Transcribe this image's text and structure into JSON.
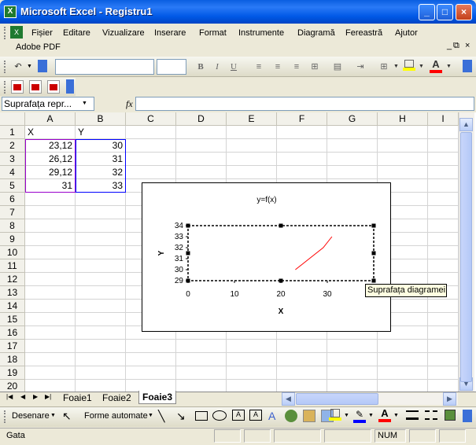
{
  "window": {
    "title": "Microsoft Excel - Registru1",
    "controls": [
      "_",
      "□",
      "×"
    ]
  },
  "menu": {
    "items": [
      "Fișier",
      "Editare",
      "Vizualizare",
      "Inserare",
      "Format",
      "Instrumente",
      "Diagramă",
      "Fereastră",
      "Ajutor"
    ],
    "adobe": "Adobe PDF"
  },
  "formula_bar": {
    "name_box": "Suprafața repr...",
    "fx": "fx"
  },
  "grid": {
    "columns": [
      "A",
      "B",
      "C",
      "D",
      "E",
      "F",
      "G",
      "H",
      "I"
    ],
    "rows": [
      "1",
      "2",
      "3",
      "4",
      "5",
      "6",
      "7",
      "8",
      "9",
      "10",
      "11",
      "12",
      "13",
      "14",
      "15",
      "16",
      "17",
      "18",
      "19",
      "20"
    ],
    "cells": {
      "A1": "X",
      "B1": "Y",
      "A2": "23,12",
      "B2": "30",
      "A3": "26,12",
      "B3": "31",
      "A4": "29,12",
      "B4": "32",
      "A5": "31",
      "B5": "33"
    }
  },
  "chart_data": {
    "type": "line",
    "title": "y=f(x)",
    "xlabel": "X",
    "ylabel": "Y",
    "x": [
      23.12,
      26.12,
      29.12,
      31
    ],
    "series": [
      {
        "values": [
          30,
          31,
          32,
          33
        ],
        "color": "#ff0000"
      }
    ],
    "xlim": [
      0,
      40
    ],
    "ylim": [
      29,
      34
    ],
    "x_ticks": [
      "0",
      "10",
      "20",
      "30"
    ],
    "y_ticks": [
      "34",
      "33",
      "32",
      "31",
      "30",
      "29"
    ],
    "grid": false
  },
  "tooltip": "Suprafața diagramei",
  "sheet_tabs": [
    "Foaie1",
    "Foaie2",
    "Foaie3"
  ],
  "active_tab": "Foaie3",
  "draw_toolbar": {
    "draw": "Desenare",
    "autoshapes": "Forme automate"
  },
  "status": {
    "left": "Gata",
    "num": "NUM"
  }
}
